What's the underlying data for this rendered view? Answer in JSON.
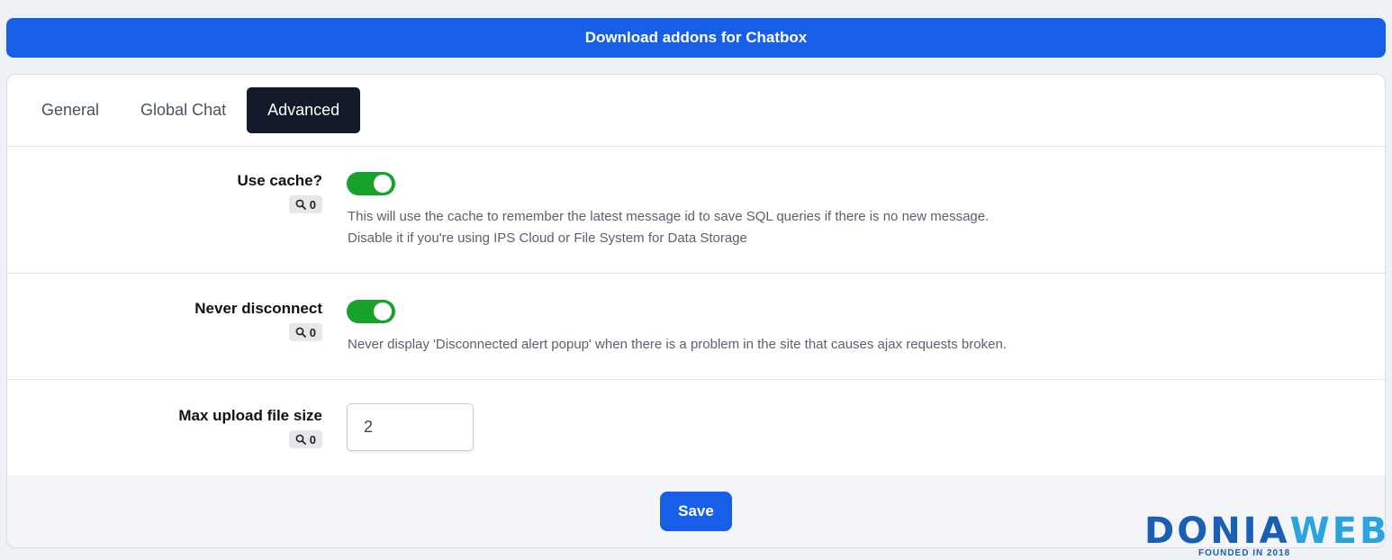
{
  "banner": {
    "label": "Download addons for Chatbox"
  },
  "tabs": [
    {
      "label": "General",
      "active": false
    },
    {
      "label": "Global Chat",
      "active": false
    },
    {
      "label": "Advanced",
      "active": true
    }
  ],
  "settings": {
    "use_cache": {
      "label": "Use cache?",
      "search_count": "0",
      "enabled": true,
      "description_line1": "This will use the cache to remember the latest message id to save SQL queries if there is no new message.",
      "description_line2": "Disable it if you're using IPS Cloud or File System for Data Storage"
    },
    "never_disconnect": {
      "label": "Never disconnect",
      "search_count": "0",
      "enabled": true,
      "description": "Never display 'Disconnected alert popup' when there is a problem in the site that causes ajax requests broken."
    },
    "max_upload": {
      "label": "Max upload file size",
      "search_count": "0",
      "value": "2"
    }
  },
  "footer": {
    "save_label": "Save"
  },
  "watermark": {
    "word_part1": "DONIA",
    "word_part2": "WEB",
    "tagline": "FOUNDED IN 2018"
  },
  "colors": {
    "accent": "#175fe8",
    "toggle_on": "#17a22b",
    "active_tab": "#131b2b"
  }
}
